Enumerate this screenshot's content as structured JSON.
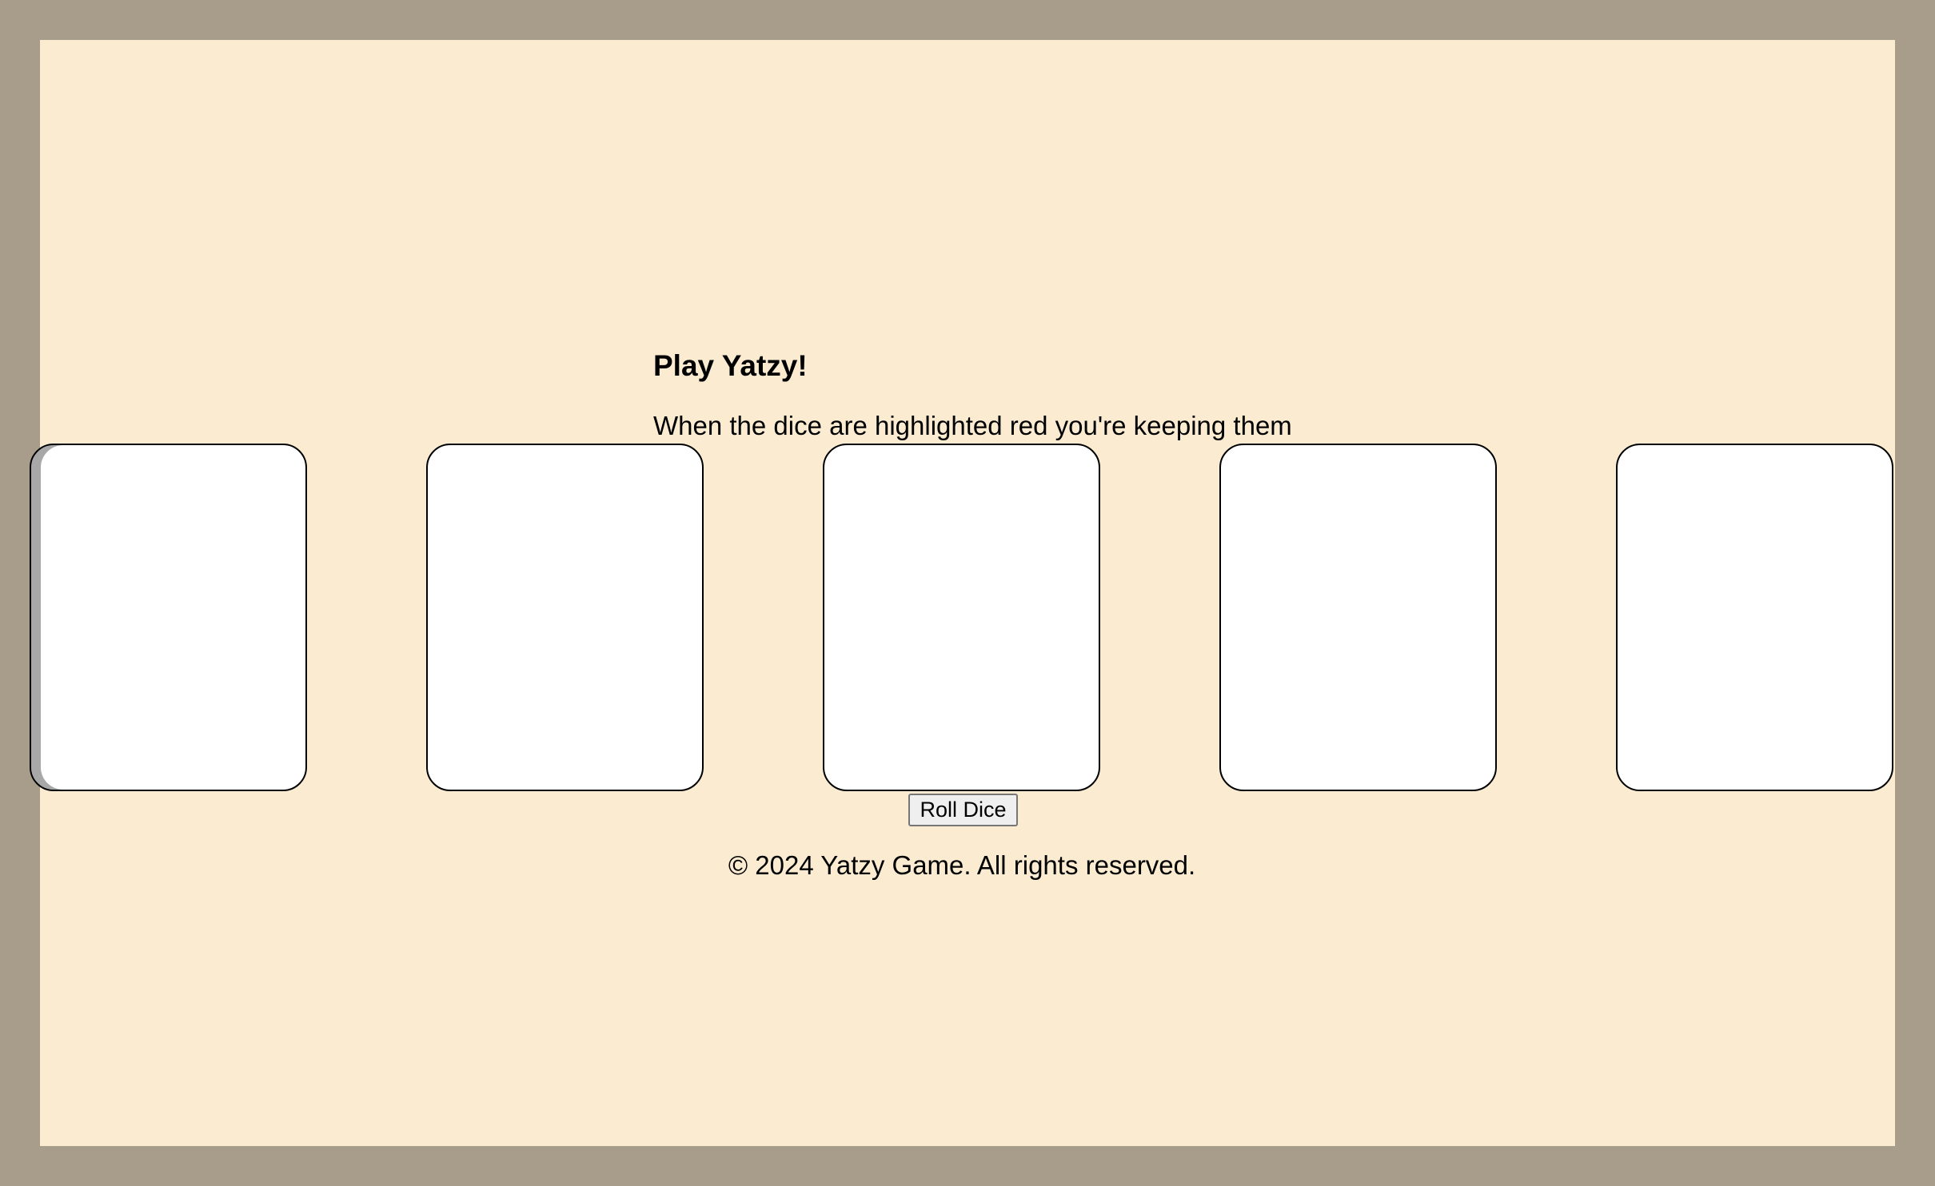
{
  "heading": "Play Yatzy!",
  "instruction": "When the dice are highlighted red you're keeping them",
  "roll_button_label": "Roll Dice",
  "footer": "© 2024 Yatzy Game. All rights reserved.",
  "colors": {
    "page_border": "#a89d8a",
    "panel_background": "#fbecd1",
    "die_background": "#ffffff"
  }
}
